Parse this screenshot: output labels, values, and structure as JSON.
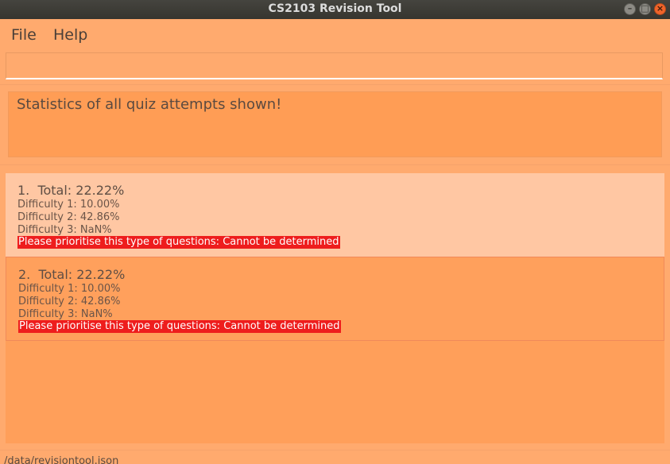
{
  "window": {
    "title": "CS2103 Revision Tool",
    "controls": {
      "minimize": "–",
      "maximize": "□",
      "close": "×"
    }
  },
  "menu": {
    "file": "File",
    "help": "Help"
  },
  "command_box": {
    "value": "",
    "placeholder": ""
  },
  "result_display": {
    "text": "Statistics of all quiz attempts shown!"
  },
  "stats": [
    {
      "total": "1.  Total: 22.22%",
      "difficulty1": "Difficulty 1: 10.00%",
      "difficulty2": "Difficulty 2: 42.86%",
      "difficulty3": "Difficulty 3: NaN%",
      "recommendation": "Please prioritise this type of questions: Cannot be determined"
    },
    {
      "total": "2.  Total: 22.22%",
      "difficulty1": "Difficulty 1: 10.00%",
      "difficulty2": "Difficulty 2: 42.86%",
      "difficulty3": "Difficulty 3: NaN%",
      "recommendation": "Please prioritise this type of questions: Cannot be determined"
    }
  ],
  "status_bar": {
    "path": "/data/revisiontool.json"
  },
  "colors": {
    "background": "#ffaa6e",
    "card_light": "#ffc7a3",
    "card_selected": "#ffa05c",
    "warning": "#ee1d1d"
  }
}
